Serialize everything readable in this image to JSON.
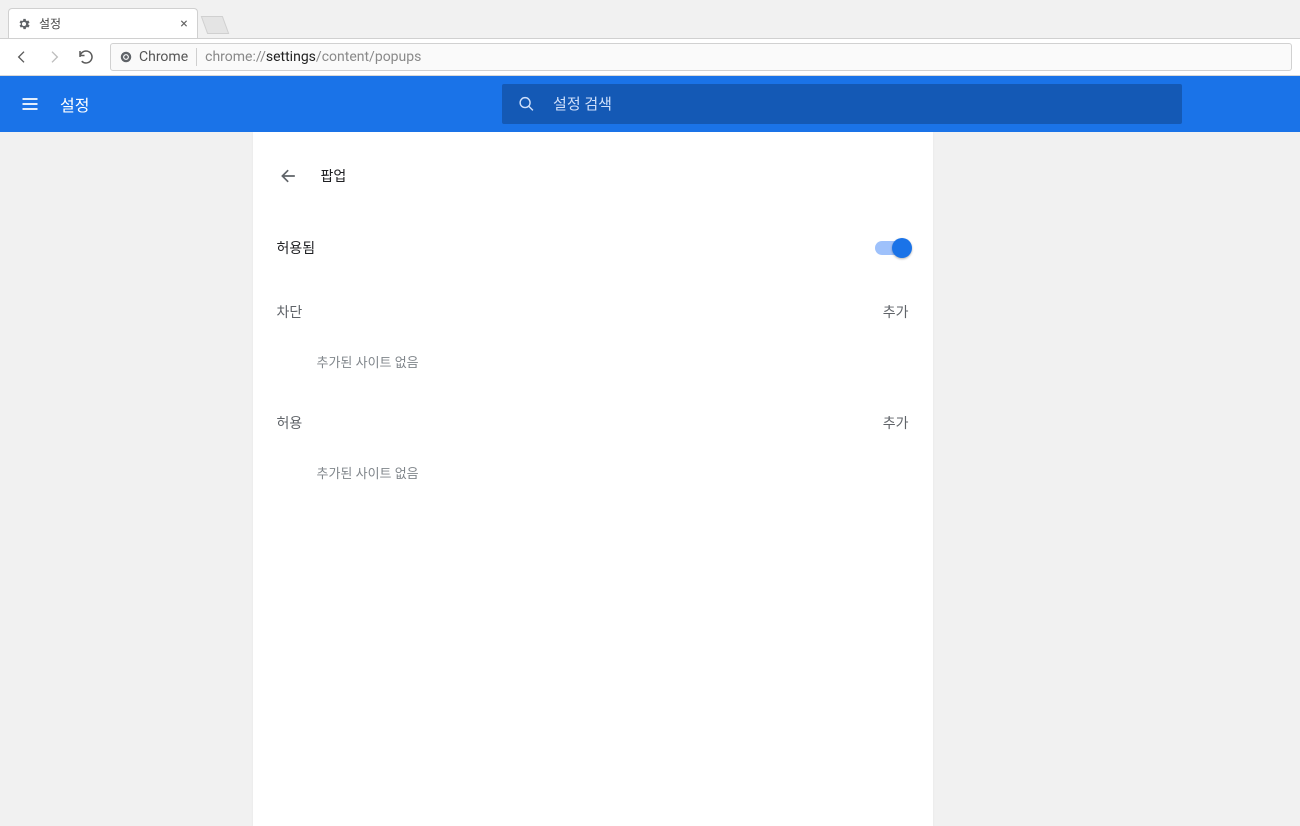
{
  "browser": {
    "tab_title": "설정",
    "scheme_label": "Chrome",
    "url_parts": {
      "pre": "chrome://",
      "bold": "settings",
      "post": "/content/popups"
    }
  },
  "appbar": {
    "title": "설정",
    "search_placeholder": "설정 검색",
    "accent_color": "#1a73e8"
  },
  "page": {
    "title": "팝업",
    "allowed_label": "허용됨",
    "allowed_state": true,
    "sections": [
      {
        "title": "차단",
        "add_label": "추가",
        "empty_message": "추가된 사이트 없음"
      },
      {
        "title": "허용",
        "add_label": "추가",
        "empty_message": "추가된 사이트 없음"
      }
    ]
  }
}
